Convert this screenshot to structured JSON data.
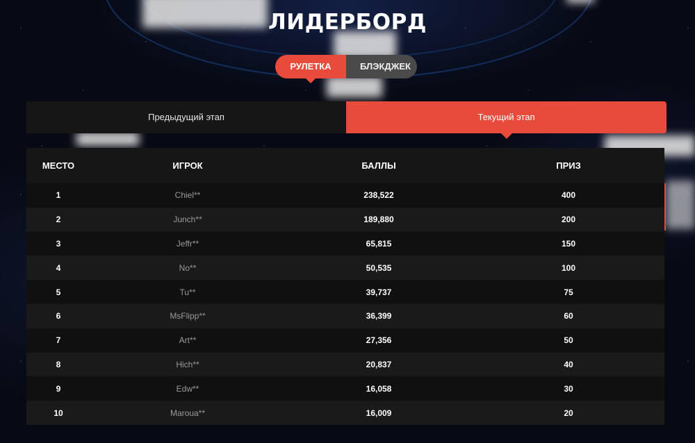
{
  "page": {
    "title": "ЛИДЕРБОРД"
  },
  "game_tabs": [
    {
      "label": "РУЛЕТКА",
      "active": true
    },
    {
      "label": "БЛЭКДЖЕК",
      "active": false
    }
  ],
  "stage_tabs": [
    {
      "label": "Предыдущий этап",
      "active": false
    },
    {
      "label": "Текущий этап",
      "active": true
    }
  ],
  "table": {
    "headers": [
      "МЕСТО",
      "ИГРОК",
      "БАЛЛЫ",
      "ПРИЗ"
    ],
    "rows": [
      {
        "place": "1",
        "player": "Chiel**",
        "points": "238,522",
        "prize": "400"
      },
      {
        "place": "2",
        "player": "Junch**",
        "points": "189,880",
        "prize": "200"
      },
      {
        "place": "3",
        "player": "Jeffr**",
        "points": "65,815",
        "prize": "150"
      },
      {
        "place": "4",
        "player": "No**",
        "points": "50,535",
        "prize": "100"
      },
      {
        "place": "5",
        "player": "Tu**",
        "points": "39,737",
        "prize": "75"
      },
      {
        "place": "6",
        "player": "MsFlipp**",
        "points": "36,399",
        "prize": "60"
      },
      {
        "place": "7",
        "player": "Art**",
        "points": "27,356",
        "prize": "50"
      },
      {
        "place": "8",
        "player": "Hich**",
        "points": "20,837",
        "prize": "40"
      },
      {
        "place": "9",
        "player": "Edw**",
        "points": "16,058",
        "prize": "30"
      },
      {
        "place": "10",
        "player": "Maroua**",
        "points": "16,009",
        "prize": "20"
      }
    ]
  },
  "colors": {
    "accent": "#e84b3c",
    "background": "#070a14",
    "panel": "#161616"
  }
}
